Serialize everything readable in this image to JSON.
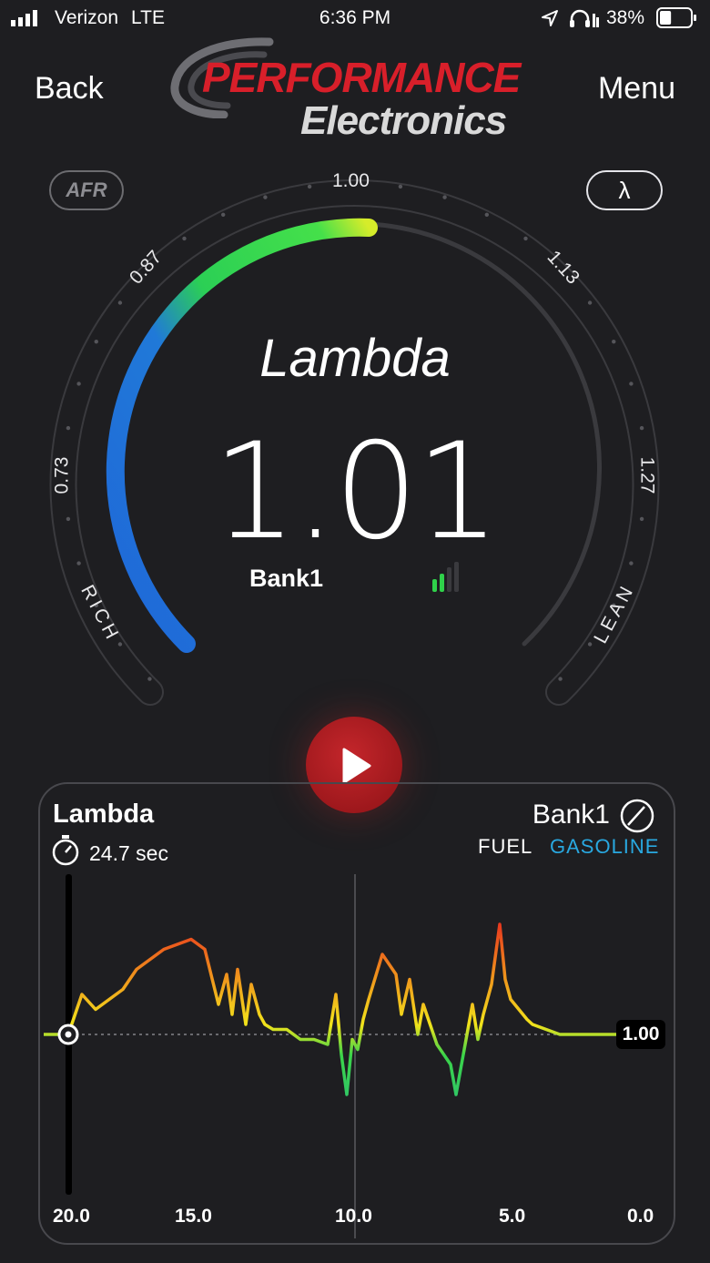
{
  "status_bar": {
    "carrier": "Verizon",
    "network": "LTE",
    "time": "6:36 PM",
    "battery": "38%",
    "battery_level": 0.38
  },
  "nav": {
    "back_label": "Back",
    "menu_label": "Menu",
    "logo_top": "PERFORMANCE",
    "logo_bottom": "Electronics"
  },
  "gauge": {
    "afr_toggle": "AFR",
    "lambda_toggle": "λ",
    "scale_labels": {
      "top": "1.00",
      "upper_left": "0.87",
      "upper_right": "1.13",
      "left": "0.73",
      "right": "1.27",
      "bottom_left": "RICH",
      "bottom_right": "LEAN"
    },
    "title": "Lambda",
    "value": "1.01",
    "bank": "Bank1",
    "signal_bars_active": 2,
    "signal_bars_total": 4
  },
  "chart": {
    "title": "Lambda",
    "duration": "24.7 sec",
    "bank": "Bank1",
    "fuel_label": "FUEL",
    "fuel_value": "GASOLINE",
    "reference_value": "1.00",
    "x_ticks": [
      "20.0",
      "15.0",
      "10.0",
      "5.0",
      "0.0"
    ],
    "colors": {
      "rich": "#1e63d6",
      "stoich": "#36d14a",
      "lean_mild": "#f2e31b",
      "lean": "#e8311e"
    }
  },
  "chart_data": {
    "type": "line",
    "xlabel": "",
    "ylabel": "",
    "xlim": [
      20,
      0
    ],
    "x": [
      20.0,
      19.5,
      19.0,
      18.5,
      18.0,
      17.5,
      17.0,
      16.5,
      16.0,
      15.5,
      15.0,
      14.5,
      14.2,
      14.0,
      13.8,
      13.5,
      13.3,
      13.0,
      12.8,
      12.5,
      12.0,
      11.5,
      11.0,
      10.5,
      10.2,
      10.0,
      9.8,
      9.6,
      9.4,
      9.2,
      9.0,
      8.5,
      8.0,
      7.8,
      7.5,
      7.2,
      7.0,
      6.5,
      6.0,
      5.8,
      5.5,
      5.2,
      5.0,
      4.8,
      4.5,
      4.2,
      4.0,
      3.8,
      3.5,
      3.2,
      3.0,
      2.5,
      2.0,
      1.5,
      1.0,
      0.5,
      0.0
    ],
    "series": [
      {
        "values": [
          1.0,
          1.08,
          1.05,
          1.07,
          1.09,
          1.13,
          1.15,
          1.17,
          1.18,
          1.19,
          1.17,
          1.06,
          1.12,
          1.04,
          1.13,
          1.02,
          1.1,
          1.04,
          1.02,
          1.01,
          1.01,
          0.99,
          0.99,
          0.98,
          1.08,
          0.96,
          0.88,
          0.99,
          0.97,
          1.03,
          1.07,
          1.16,
          1.12,
          1.04,
          1.11,
          1.0,
          1.06,
          0.98,
          0.94,
          0.88,
          0.97,
          1.06,
          0.99,
          1.04,
          1.1,
          1.22,
          1.11,
          1.07,
          1.05,
          1.03,
          1.02,
          1.01,
          1.0,
          1.0,
          1.0,
          1.0,
          1.0
        ]
      }
    ]
  }
}
